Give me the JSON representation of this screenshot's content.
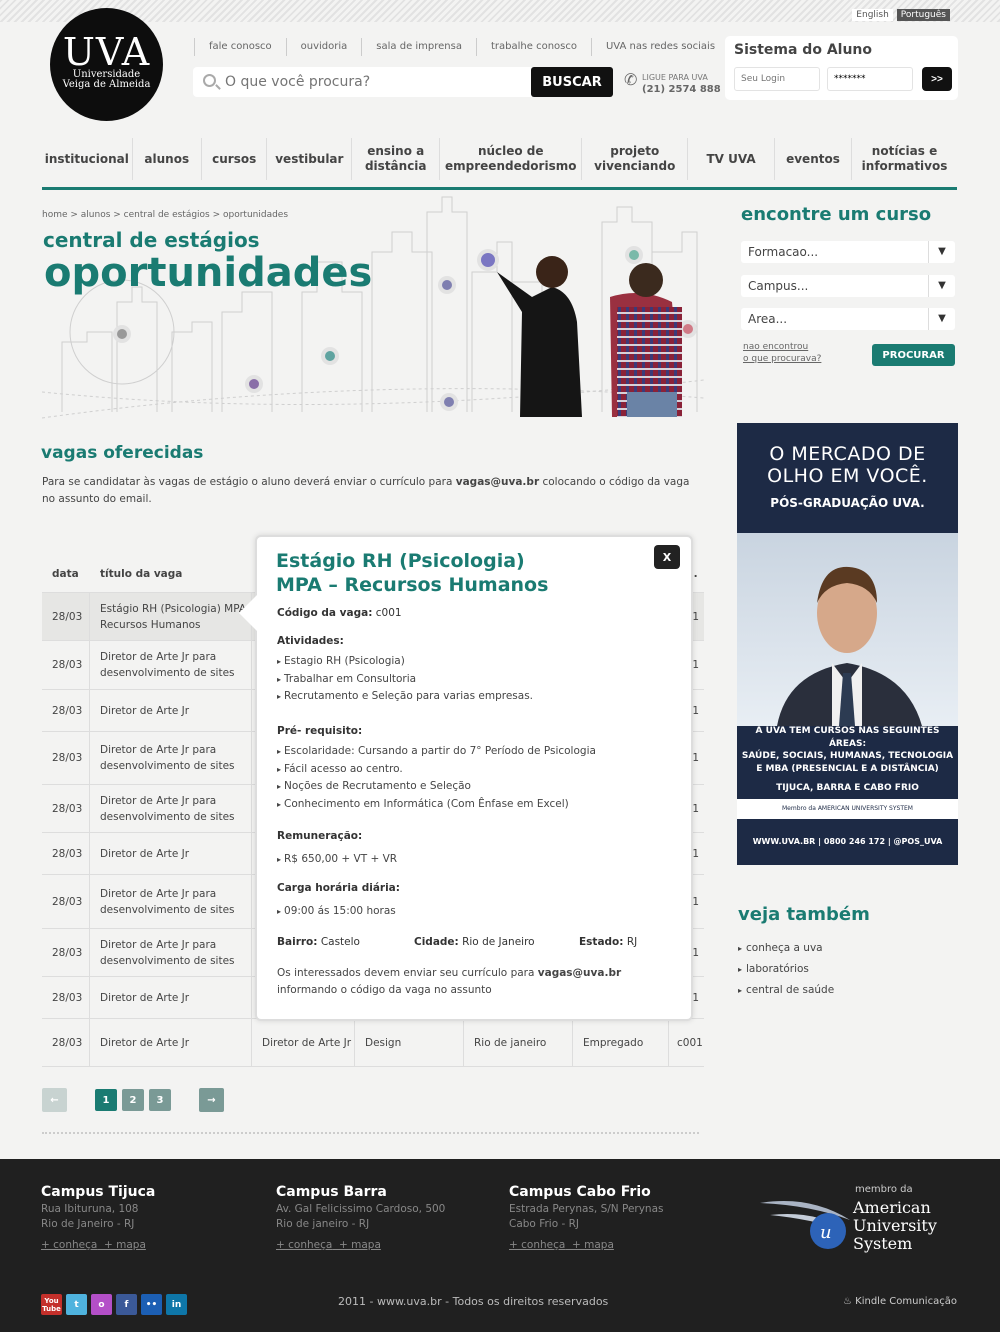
{
  "lang": [
    "English",
    "Português"
  ],
  "logo": {
    "big": "UVA",
    "line1": "Universidade",
    "line2": "Veiga de Almeida"
  },
  "top_links": [
    "fale conosco",
    "ouvidoria",
    "sala de imprensa",
    "trabalhe conosco",
    "UVA nas redes sociais"
  ],
  "search": {
    "placeholder": "O que você procura?",
    "button": "BUSCAR"
  },
  "phone": {
    "label": "LIGUE PARA UVA",
    "number": "(21) 2574 888"
  },
  "login": {
    "title": "Sistema do Aluno",
    "user_placeholder": "Seu Login",
    "pass_value": "*******",
    "submit": ">>"
  },
  "nav": [
    "institucional",
    "alunos",
    "cursos",
    "vestibular",
    "ensino a distância",
    "núcleo de empreendedorismo",
    "projeto vivenciando",
    "TV UVA",
    "eventos",
    "notícias e informativos"
  ],
  "breadcrumb": "home > alunos > central de estágios > oportunidades",
  "page": {
    "subtitle": "central de estágios",
    "title": "oportunidades"
  },
  "vagas": {
    "title": "vagas oferecidas",
    "intro_pre": "Para se candidatar às vagas de estágio o aluno deverá enviar o currículo para ",
    "intro_email": "vagas@uva.br",
    "intro_post": " colocando o código da vaga no assunto do email."
  },
  "table": {
    "col_date": "data",
    "col_title": "título da vaga",
    "col_code_partial": "l.",
    "rows": [
      {
        "date": "28/03",
        "title": "Estágio RH (Psicologia) MPA- Recursos Humanos",
        "code": "1"
      },
      {
        "date": "28/03",
        "title": "Diretor de Arte Jr para desenvolvimento de sites",
        "code": "1"
      },
      {
        "date": "28/03",
        "title": "Diretor de Arte Jr",
        "code": "1"
      },
      {
        "date": "28/03",
        "title": "Diretor de Arte Jr para desenvolvimento de sites",
        "code": "1"
      },
      {
        "date": "28/03",
        "title": "Diretor de Arte Jr para desenvolvimento de sites",
        "code": "1"
      },
      {
        "date": "28/03",
        "title": "Diretor de Arte Jr",
        "code": "1"
      },
      {
        "date": "28/03",
        "title": "Diretor de Arte Jr para desenvolvimento de sites",
        "code": "1"
      },
      {
        "date": "28/03",
        "title": "Diretor de Arte Jr para desenvolvimento de sites",
        "code": "1"
      },
      {
        "date": "28/03",
        "title": "Diretor de Arte Jr",
        "code": "1"
      }
    ],
    "last_row": {
      "date": "28/03",
      "title": "Diretor de Arte Jr",
      "cargo": "Diretor de Arte Jr",
      "area": "Design",
      "cidade": "Rio de janeiro",
      "situacao": "Empregado",
      "code": "c001"
    }
  },
  "pager": {
    "prev": "←",
    "pages": [
      "1",
      "2",
      "3"
    ],
    "next": "→"
  },
  "popup": {
    "close": "X",
    "title1": "Estágio RH (Psicologia)",
    "title2": "MPA – Recursos Humanos",
    "code_label": "Código da vaga:",
    "code_value": "c001",
    "atividades_label": "Atividades:",
    "atividades": [
      "Estagio RH (Psicologia)",
      "Trabalhar em Consultoria",
      "Recrutamento e Seleção para varias empresas."
    ],
    "prereq_label": "Pré- requisito:",
    "prereq": [
      "Escolaridade: Cursando a partir do 7° Período de Psicologia",
      "Fácil acesso ao centro.",
      "Noções de Recrutamento e Seleção",
      "Conhecimento em Informática (Com Ênfase em Excel)"
    ],
    "rem_label": "Remuneração:",
    "rem": [
      "R$ 650,00 + VT + VR"
    ],
    "carga_label": "Carga horária diária:",
    "carga": [
      "09:00 ás 15:00 horas"
    ],
    "bairro_label": "Bairro:",
    "bairro": "Castelo",
    "cidade_label": "Cidade:",
    "cidade": "Rio de Janeiro",
    "estado_label": "Estado:",
    "estado": "RJ",
    "footer_pre": "Os interessados devem enviar seu currículo para ",
    "footer_email": "vagas@uva.br",
    "footer_post": " informando o código da vaga no assunto"
  },
  "curso_finder": {
    "title": "encontre um curso",
    "selects": [
      "Formacao...",
      "Campus...",
      "Area..."
    ],
    "not_found_1": "nao encontrou",
    "not_found_2": "o que procurava?",
    "button": "PROCURAR"
  },
  "ad": {
    "headline1": "O MERCADO DE",
    "headline2": "OLHO EM VOCÊ.",
    "sub": "PÓS-GRADUAÇÃO UVA.",
    "info1": "A UVA TEM CURSOS NAS SEGUINTES ÁREAS:",
    "info2": "SAÚDE, SOCIAIS, HUMANAS, TECNOLOGIA",
    "info3": "E MBA (PRESENCIAL E A DISTÂNCIA)",
    "info4": "TIJUCA, BARRA E CABO FRIO",
    "member": "Membro da AMERICAN UNIVERSITY SYSTEM",
    "footer": "WWW.UVA.BR | 0800 246 172 | @POS_UVA"
  },
  "veja": {
    "title": "veja também",
    "links": [
      "conheça a uva",
      "laboratórios",
      "central de saúde"
    ]
  },
  "footer": {
    "campuses": [
      {
        "name": "Campus Tijuca",
        "addr1": "Rua Ibituruna, 108",
        "addr2": "Rio de Janeiro - RJ",
        "l1": "+ conheça",
        "l2": "+ mapa"
      },
      {
        "name": "Campus Barra",
        "addr1": "Av. Gal Felicissimo Cardoso, 500",
        "addr2": "Rio de janeiro - RJ",
        "l1": "+ conheça",
        "l2": "+ mapa"
      },
      {
        "name": "Campus Cabo Frio",
        "addr1": "Estrada Perynas, S/N Perynas",
        "addr2": "Cabo Frio - RJ",
        "l1": "+ conheça",
        "l2": "+ mapa"
      }
    ],
    "member_of": "membro da",
    "aus1": "American",
    "aus2": "University",
    "aus3": "System",
    "copyright": "2011 - www.uva.br - Todos os direitos reservados",
    "credit": "Kindle Comunicação",
    "social": [
      "You Tube",
      "t",
      "o",
      "f",
      "••",
      "in"
    ]
  },
  "colors": {
    "accent": "#1a7b72",
    "footer": "#202020",
    "ad_bg": "#1d2a45"
  }
}
